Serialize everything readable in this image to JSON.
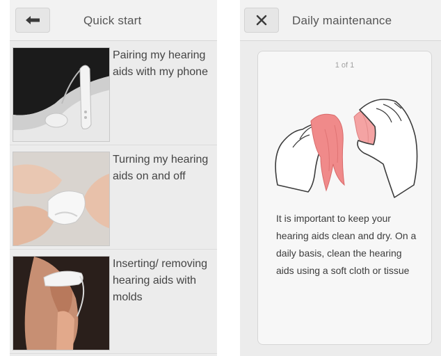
{
  "quick_start": {
    "title": "Quick start",
    "items": [
      {
        "label": "Pairing my hearing aids with my phone"
      },
      {
        "label": "Turning my hearing aids on and off"
      },
      {
        "label": "Inserting/ removing hearing aids with molds"
      }
    ]
  },
  "daily_maintenance": {
    "title": "Daily maintenance",
    "pager": "1 of 1",
    "body": "It is important to keep your hearing aids clean and dry. On a daily basis, clean the hearing aids using a soft cloth or tissue"
  },
  "icons": {
    "back": "arrow-left-icon",
    "close": "close-icon"
  },
  "colors": {
    "screen_bg": "#ececec",
    "cloth": "#f08a8a",
    "header_bg": "#f2f2f2"
  }
}
